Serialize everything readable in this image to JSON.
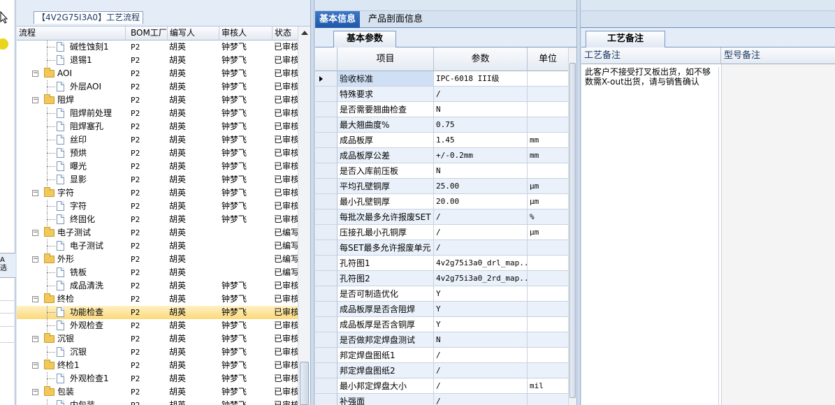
{
  "tree": {
    "title": "【4V2G75I3A0】工艺流程",
    "columns": [
      "流程",
      "BOM工厂",
      "编写人",
      "审核人",
      "状态"
    ],
    "rows": [
      {
        "level": 2,
        "type": "doc",
        "name": "碱性蚀刻1",
        "bom": "P2",
        "writer": "胡英",
        "reviewer": "钟梦飞",
        "status": "已审核"
      },
      {
        "level": 2,
        "type": "doc",
        "name": "退锡1",
        "bom": "P2",
        "writer": "胡英",
        "reviewer": "钟梦飞",
        "status": "已审核"
      },
      {
        "level": 1,
        "type": "folder",
        "name": "AOI",
        "bom": "P2",
        "writer": "胡英",
        "reviewer": "钟梦飞",
        "status": "已审核"
      },
      {
        "level": 2,
        "type": "doc",
        "name": "外层AOI",
        "bom": "P2",
        "writer": "胡英",
        "reviewer": "钟梦飞",
        "status": "已审核"
      },
      {
        "level": 1,
        "type": "folder",
        "name": "阻焊",
        "bom": "P2",
        "writer": "胡英",
        "reviewer": "钟梦飞",
        "status": "已审核"
      },
      {
        "level": 2,
        "type": "doc",
        "name": "阻焊前处理",
        "bom": "P2",
        "writer": "胡英",
        "reviewer": "钟梦飞",
        "status": "已审核"
      },
      {
        "level": 2,
        "type": "doc",
        "name": "阻焊塞孔",
        "bom": "P2",
        "writer": "胡英",
        "reviewer": "钟梦飞",
        "status": "已审核"
      },
      {
        "level": 2,
        "type": "doc",
        "name": "丝印",
        "bom": "P2",
        "writer": "胡英",
        "reviewer": "钟梦飞",
        "status": "已审核"
      },
      {
        "level": 2,
        "type": "doc",
        "name": "预烘",
        "bom": "P2",
        "writer": "胡英",
        "reviewer": "钟梦飞",
        "status": "已审核"
      },
      {
        "level": 2,
        "type": "doc",
        "name": "曝光",
        "bom": "P2",
        "writer": "胡英",
        "reviewer": "钟梦飞",
        "status": "已审核"
      },
      {
        "level": 2,
        "type": "doc",
        "name": "显影",
        "bom": "P2",
        "writer": "胡英",
        "reviewer": "钟梦飞",
        "status": "已审核"
      },
      {
        "level": 1,
        "type": "folder",
        "name": "字符",
        "bom": "P2",
        "writer": "胡英",
        "reviewer": "钟梦飞",
        "status": "已审核"
      },
      {
        "level": 2,
        "type": "doc",
        "name": "字符",
        "bom": "P2",
        "writer": "胡英",
        "reviewer": "钟梦飞",
        "status": "已审核"
      },
      {
        "level": 2,
        "type": "doc",
        "name": "终固化",
        "bom": "P2",
        "writer": "胡英",
        "reviewer": "钟梦飞",
        "status": "已审核"
      },
      {
        "level": 1,
        "type": "folder",
        "name": "电子测试",
        "bom": "P2",
        "writer": "胡英",
        "reviewer": "",
        "status": "已编写"
      },
      {
        "level": 2,
        "type": "doc",
        "name": "电子测试",
        "bom": "P2",
        "writer": "胡英",
        "reviewer": "",
        "status": "已编写"
      },
      {
        "level": 1,
        "type": "folder",
        "name": "外形",
        "bom": "P2",
        "writer": "胡英",
        "reviewer": "",
        "status": "已编写"
      },
      {
        "level": 2,
        "type": "doc",
        "name": "铣板",
        "bom": "P2",
        "writer": "胡英",
        "reviewer": "",
        "status": "已编写"
      },
      {
        "level": 2,
        "type": "doc",
        "name": "成品清洗",
        "bom": "P2",
        "writer": "胡英",
        "reviewer": "钟梦飞",
        "status": "已审核"
      },
      {
        "level": 1,
        "type": "folder",
        "name": "终检",
        "bom": "P2",
        "writer": "胡英",
        "reviewer": "钟梦飞",
        "status": "已审核"
      },
      {
        "level": 2,
        "type": "doc",
        "name": "功能检查",
        "bom": "P2",
        "writer": "胡英",
        "reviewer": "钟梦飞",
        "status": "已审核",
        "selected": true
      },
      {
        "level": 2,
        "type": "doc",
        "name": "外观检查",
        "bom": "P2",
        "writer": "胡英",
        "reviewer": "钟梦飞",
        "status": "已审核"
      },
      {
        "level": 1,
        "type": "folder",
        "name": "沉银",
        "bom": "P2",
        "writer": "胡英",
        "reviewer": "钟梦飞",
        "status": "已审核"
      },
      {
        "level": 2,
        "type": "doc",
        "name": "沉银",
        "bom": "P2",
        "writer": "胡英",
        "reviewer": "钟梦飞",
        "status": "已审核"
      },
      {
        "level": 1,
        "type": "folder",
        "name": "终检1",
        "bom": "P2",
        "writer": "胡英",
        "reviewer": "钟梦飞",
        "status": "已审核"
      },
      {
        "level": 2,
        "type": "doc",
        "name": "外观检查1",
        "bom": "P2",
        "writer": "胡英",
        "reviewer": "钟梦飞",
        "status": "已审核"
      },
      {
        "level": 1,
        "type": "folder",
        "name": "包装",
        "bom": "P2",
        "writer": "胡英",
        "reviewer": "钟梦飞",
        "status": "已审核"
      },
      {
        "level": 2,
        "type": "doc",
        "name": "内包装",
        "bom": "P2",
        "writer": "胡英",
        "reviewer": "钟梦飞",
        "status": "已审核"
      }
    ]
  },
  "left_strip": {
    "tab_label": "A\n选"
  },
  "top_tabs": [
    "基本信息",
    "产品剖面信息"
  ],
  "basic": {
    "tab": "基本参数",
    "columns": [
      "项目",
      "参数",
      "单位"
    ],
    "rows": [
      {
        "item": "验收标准",
        "value": "IPC-6018 III级",
        "unit": ""
      },
      {
        "item": "特殊要求",
        "value": "/",
        "unit": ""
      },
      {
        "item": "是否需要翘曲检查",
        "value": "N",
        "unit": ""
      },
      {
        "item": "最大翘曲度%",
        "value": "0.75",
        "unit": ""
      },
      {
        "item": "成品板厚",
        "value": "1.45",
        "unit": "mm"
      },
      {
        "item": "成品板厚公差",
        "value": "+/-0.2mm",
        "unit": "mm"
      },
      {
        "item": "是否入库前压板",
        "value": "N",
        "unit": ""
      },
      {
        "item": "平均孔壁铜厚",
        "value": "25.00",
        "unit": "μm"
      },
      {
        "item": "最小孔壁铜厚",
        "value": "20.00",
        "unit": "μm"
      },
      {
        "item": "每批次最多允许报废SET",
        "value": "/",
        "unit": "%"
      },
      {
        "item": "压接孔最小孔铜厚",
        "value": "/",
        "unit": "μm"
      },
      {
        "item": "每SET最多允许报废单元",
        "value": "/",
        "unit": ""
      },
      {
        "item": "孔符图1",
        "value": "4v2g75i3a0_drl_map...",
        "unit": ""
      },
      {
        "item": "孔符图2",
        "value": "4v2g75i3a0_2rd_map...",
        "unit": ""
      },
      {
        "item": "是否可制造优化",
        "value": "Y",
        "unit": ""
      },
      {
        "item": "成品板厚是否含阻焊",
        "value": "Y",
        "unit": ""
      },
      {
        "item": "成品板厚是否含铜厚",
        "value": "Y",
        "unit": ""
      },
      {
        "item": "是否做邦定焊盘测试",
        "value": "N",
        "unit": ""
      },
      {
        "item": "邦定焊盘图纸1",
        "value": "/",
        "unit": ""
      },
      {
        "item": "邦定焊盘图纸2",
        "value": "/",
        "unit": ""
      },
      {
        "item": "最小邦定焊盘大小",
        "value": "/",
        "unit": "mil"
      },
      {
        "item": "补强面",
        "value": "/",
        "unit": ""
      }
    ]
  },
  "notes": {
    "tab": "工艺备注",
    "col1": "工艺备注",
    "col2": "型号备注",
    "text": "此客户不接受打叉板出货，如不够数需X-out出货，请与销售确认"
  }
}
